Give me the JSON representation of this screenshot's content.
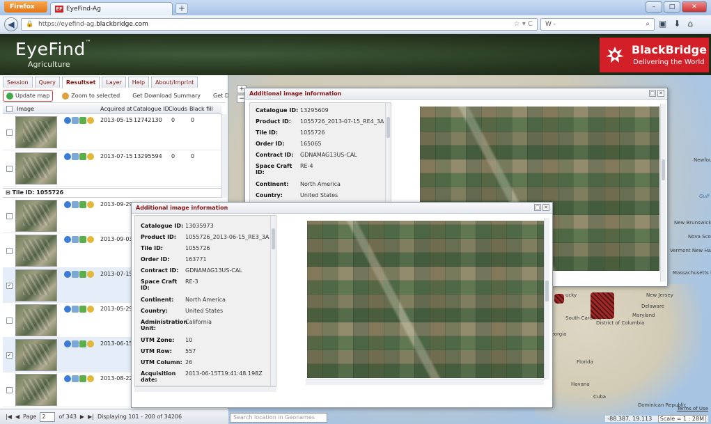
{
  "browser": {
    "app_button": "Firefox",
    "tab_title": "EyeFind-Ag",
    "tab_icon": "EF",
    "new_tab": "+",
    "url_prefix": "https://eyefind-ag.",
    "url_domain": "blackbridge.com",
    "search_placeholder": "W -"
  },
  "header": {
    "logo_main": "EyeFind",
    "logo_tm": "™",
    "logo_sub": "Agriculture",
    "brand_name": "BlackBridge",
    "brand_tagline": "Delivering the World"
  },
  "menu": {
    "tabs": [
      {
        "label": "Session"
      },
      {
        "label": "Query"
      },
      {
        "label": "Resultset"
      },
      {
        "label": "Layer"
      },
      {
        "label": "Help"
      },
      {
        "label": "About/Imprint"
      }
    ]
  },
  "toolbar": {
    "update_map": "Update map",
    "zoom_selected": "Zoom to selected",
    "download_summary": "Get Download Summary",
    "download_urls": "Get Download URLs"
  },
  "grid": {
    "columns": {
      "image": "Image",
      "acquired": "Acquired at",
      "catalogue": "Catalogue ID",
      "clouds": "Clouds",
      "blackfill": "Black fill"
    },
    "rows_top": [
      {
        "date": "2013-05-15",
        "catalogue": "12742130",
        "clouds": "0",
        "blackfill": "0",
        "checked": ""
      },
      {
        "date": "2013-07-15",
        "catalogue": "13295594",
        "clouds": "0",
        "blackfill": "0",
        "checked": ""
      }
    ],
    "group_label": "Tile ID: 1055726",
    "rows_bottom": [
      {
        "date": "2013-09-29",
        "checked": ""
      },
      {
        "date": "2013-09-03",
        "checked": ""
      },
      {
        "date": "2013-07-15",
        "checked": "✓"
      },
      {
        "date": "2013-05-29",
        "checked": ""
      },
      {
        "date": "2013-06-15",
        "checked": "✓"
      },
      {
        "date": "2013-08-22",
        "checked": ""
      }
    ]
  },
  "paging": {
    "page_label": "Page",
    "page_value": "2",
    "of_pages": "of 343",
    "display_info": "Displaying 101 - 200 of 34206"
  },
  "window_back": {
    "title": "Additional image information",
    "props": [
      {
        "k": "Catalogue ID:",
        "v": "13295609"
      },
      {
        "k": "Product ID:",
        "v": "1055726_2013-07-15_RE4_3A"
      },
      {
        "k": "Tile ID:",
        "v": "1055726"
      },
      {
        "k": "Order ID:",
        "v": "165065"
      },
      {
        "k": "Contract ID:",
        "v": "GDNAMAG13US-CAL"
      },
      {
        "k": "Space Craft ID:",
        "v": "RE-4"
      },
      {
        "k": "Continent:",
        "v": "North America"
      },
      {
        "k": "Country:",
        "v": "United States"
      }
    ]
  },
  "window_front": {
    "title": "Additional image information",
    "props": [
      {
        "k": "Catalogue ID:",
        "v": "13035973"
      },
      {
        "k": "Product ID:",
        "v": "1055726_2013-06-15_RE3_3A"
      },
      {
        "k": "Tile ID:",
        "v": "1055726"
      },
      {
        "k": "Order ID:",
        "v": "163771"
      },
      {
        "k": "Contract ID:",
        "v": "GDNAMAG13US-CAL"
      },
      {
        "k": "Space Craft ID:",
        "v": "RE-3"
      },
      {
        "k": "Continent:",
        "v": "North America"
      },
      {
        "k": "Country:",
        "v": "United States"
      },
      {
        "k": "Administration Unit:",
        "v": "California"
      },
      {
        "k": "UTM Zone:",
        "v": "10"
      },
      {
        "k": "UTM Row:",
        "v": "557"
      },
      {
        "k": "UTM Column:",
        "v": "26"
      },
      {
        "k": "Acquisition date:",
        "v": "2013-06-15T19:41:48.198Z"
      }
    ]
  },
  "map": {
    "labels": {
      "newfound": "Newfoun and Lab",
      "gulf": "Gulf o Law",
      "brunswick": "New Brunswick",
      "nova": "Nova Scotia",
      "vermont": "Vermont New Hampshire",
      "mass": "Massachusetts Island",
      "ny": "New Jersey",
      "delaware": "Delaware",
      "maryland": "Maryland",
      "sc": "South Carolina",
      "dc": "District of Columbia",
      "georgia": "Georgia",
      "florida": "Florida",
      "havana": "Havana",
      "cuba": "Cuba",
      "dominican": "Dominican Republic",
      "kucky": "ucky"
    },
    "search_placeholder": "Search location in Geonames",
    "coords": "-88.387, 19.113",
    "scale": "Scale = 1 : 28M",
    "terms": "Terms of Use"
  }
}
